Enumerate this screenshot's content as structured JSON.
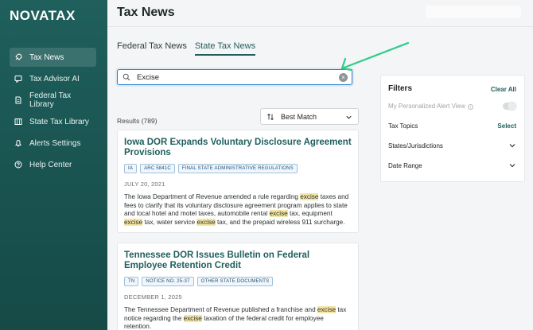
{
  "app": {
    "logo": "NOVATAX",
    "page_title": "Tax News"
  },
  "sidebar": {
    "items": [
      {
        "label": "Tax News",
        "icon": "rocket-icon",
        "active": true
      },
      {
        "label": "Tax Advisor AI",
        "icon": "chat-icon",
        "active": false
      },
      {
        "label": "Federal Tax Library",
        "icon": "document-icon",
        "active": false
      },
      {
        "label": "State Tax Library",
        "icon": "map-icon",
        "active": false
      },
      {
        "label": "Alerts Settings",
        "icon": "bell-icon",
        "active": false
      },
      {
        "label": "Help Center",
        "icon": "help-icon",
        "active": false
      }
    ]
  },
  "tabs": [
    {
      "label": "Federal Tax News",
      "active": false
    },
    {
      "label": "State Tax News",
      "active": true
    }
  ],
  "search": {
    "value": "Excise",
    "placeholder": ""
  },
  "results": {
    "count_label": "Results (789)",
    "sort_label": "Best Match"
  },
  "articles": [
    {
      "title": "Iowa DOR Expands Voluntary Disclosure Agreement Provisions",
      "tags": [
        "IA",
        "ARC 5841C",
        "FINAL STATE ADMINISTRATIVE REGULATIONS"
      ],
      "date": "JULY 20, 2021",
      "summary": [
        {
          "t": "The Iowa Department of Revenue amended a rule regarding ",
          "hl": false
        },
        {
          "t": "excise",
          "hl": true
        },
        {
          "t": " taxes and fees to clarify that its voluntary disclosure agreement program applies to state and local hotel and motel taxes, automobile rental ",
          "hl": false
        },
        {
          "t": "excise",
          "hl": true
        },
        {
          "t": " tax, equipment ",
          "hl": false
        },
        {
          "t": "excise",
          "hl": true
        },
        {
          "t": " tax, water service ",
          "hl": false
        },
        {
          "t": "excise",
          "hl": true
        },
        {
          "t": " tax, and the prepaid wireless 911 surcharge.",
          "hl": false
        }
      ]
    },
    {
      "title": "Tennessee DOR Issues Bulletin on Federal Employee Retention Credit",
      "tags": [
        "TN",
        "NOTICE NO. 25-37",
        "OTHER STATE DOCUMENTS"
      ],
      "date": "DECEMBER 1, 2025",
      "summary": [
        {
          "t": "The Tennessee Department of Revenue published a franchise and ",
          "hl": false
        },
        {
          "t": "excise",
          "hl": true
        },
        {
          "t": " tax notice regarding the ",
          "hl": false
        },
        {
          "t": "excise",
          "hl": true
        },
        {
          "t": " taxation of the federal credit for employee retention.",
          "hl": false
        }
      ]
    }
  ],
  "filters": {
    "title": "Filters",
    "clear_all": "Clear All",
    "alert_view_label": "My Personalized Alert View",
    "tax_topics_label": "Tax Topics",
    "tax_topics_action": "Select",
    "states_label": "States/Jurisdictions",
    "date_range_label": "Date Range"
  },
  "colors": {
    "brand": "#1f5f5c",
    "highlight": "#f5e7a4",
    "accent_arrow": "#2ecc8a",
    "focus": "#2a7fc9"
  }
}
